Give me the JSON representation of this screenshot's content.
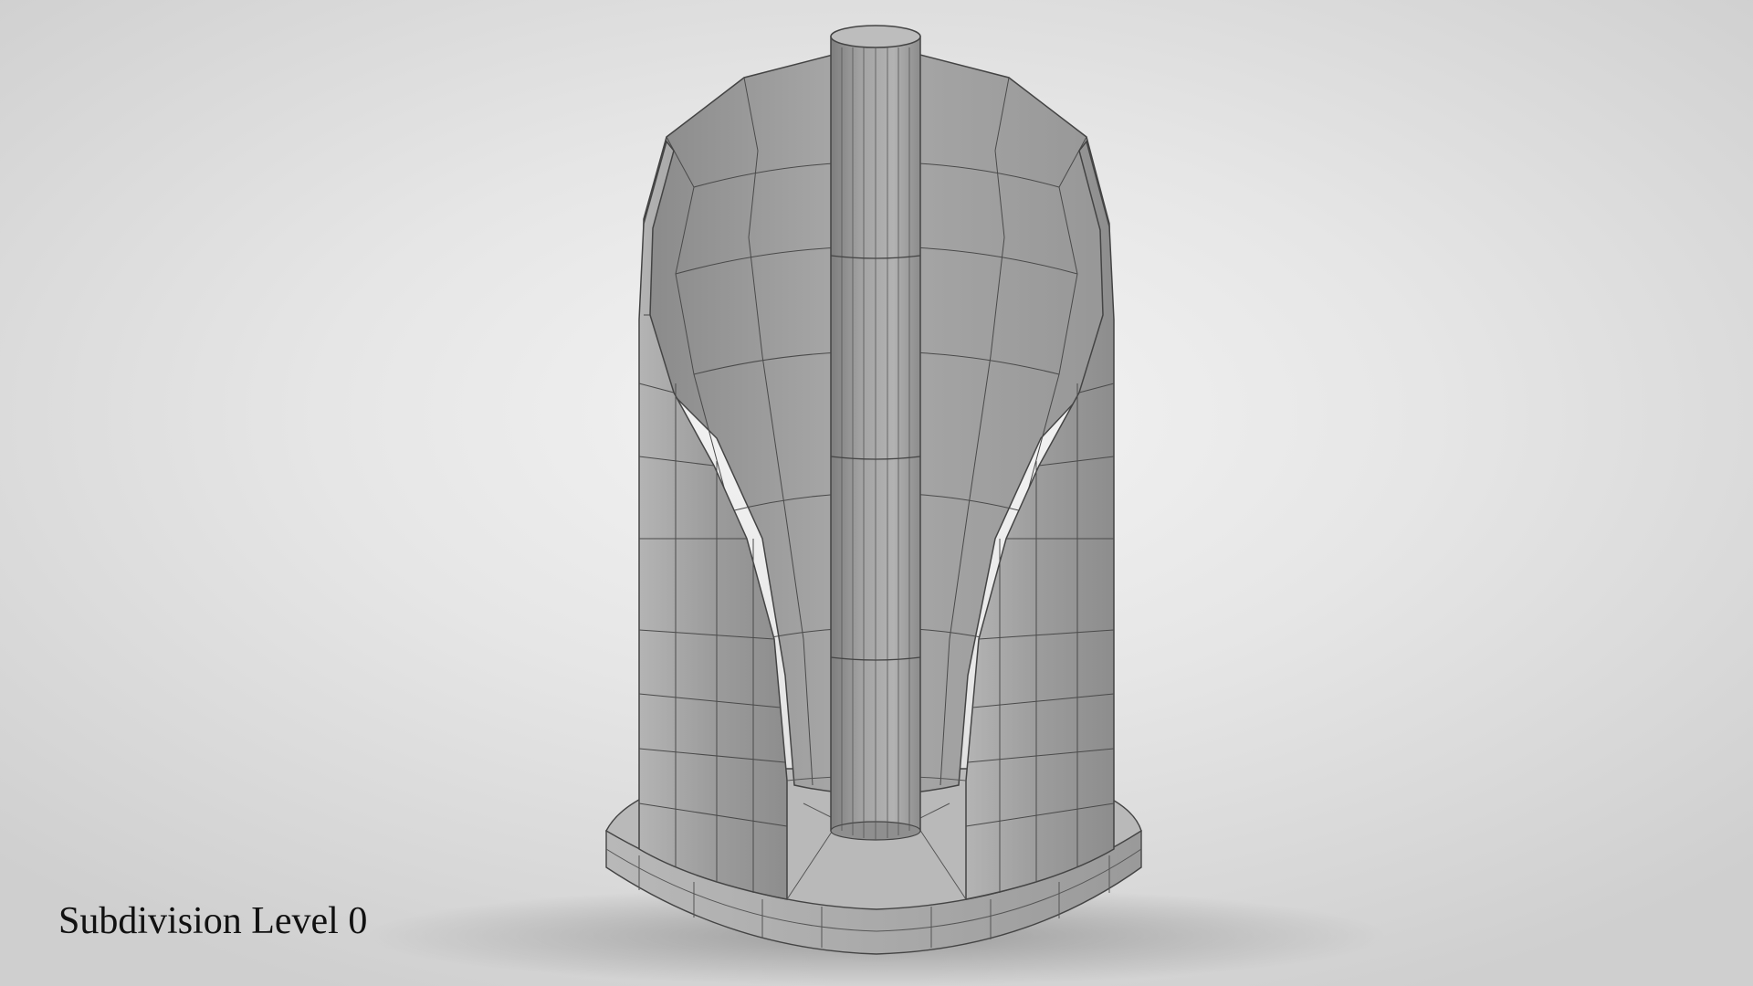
{
  "caption": "Subdivision Level 0",
  "render": {
    "subject": "paper-towel-holder-wireframe-model",
    "background_color": "#e6e6e6",
    "model_color": "#9a9a9a",
    "wire_color": "#3c3c3c"
  }
}
